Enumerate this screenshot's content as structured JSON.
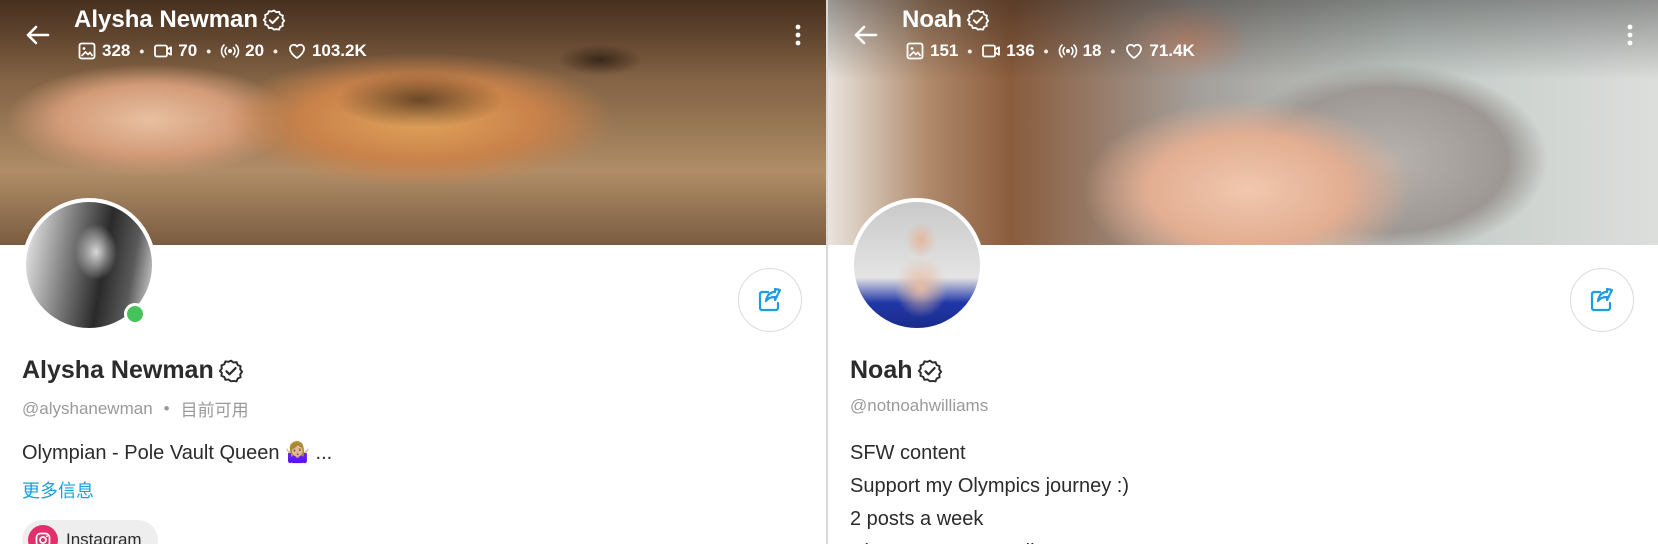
{
  "profiles": [
    {
      "header_name": "Alysha Newman",
      "stats": {
        "photos": "328",
        "videos": "70",
        "streams": "20",
        "likes": "103.2K"
      },
      "display_name": "Alysha Newman",
      "handle": "@alyshanewman",
      "status": "目前可用",
      "bio_lines": [
        "Olympian - Pole Vault Queen 🤷🏼‍♀️ ..."
      ],
      "more_info": "更多信息",
      "social": {
        "label": "Instagram"
      }
    },
    {
      "header_name": "Noah",
      "stats": {
        "photos": "151",
        "videos": "136",
        "streams": "18",
        "likes": "71.4K"
      },
      "display_name": "Noah",
      "handle": "@notnoahwilliams",
      "bio_lines": [
        "SFW content",
        "Support my Olympics journey :)",
        "2 posts a week",
        "Chat to me personally"
      ]
    }
  ],
  "theme": {
    "accent": "#1a9ee0",
    "online": "#46c25a",
    "instagram": "#e1306c"
  },
  "icons": [
    "back-arrow-icon",
    "more-vertical-icon",
    "verified-icon",
    "image-icon",
    "video-icon",
    "stream-icon",
    "heart-icon",
    "share-icon",
    "instagram-icon"
  ]
}
